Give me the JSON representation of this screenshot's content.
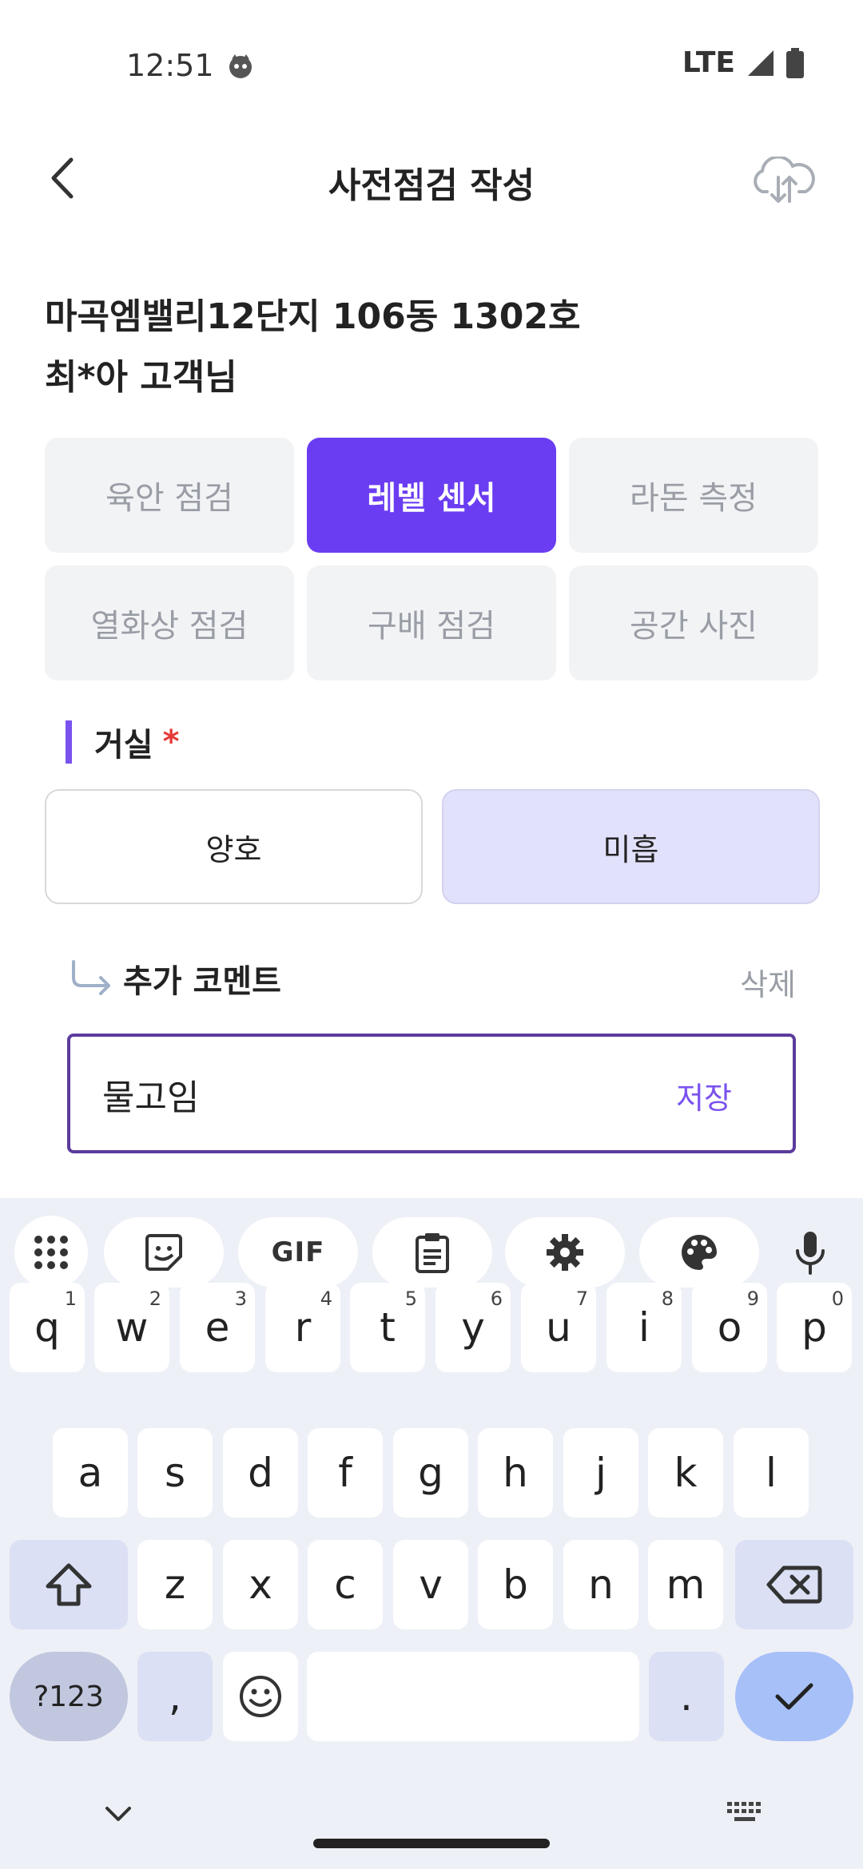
{
  "status_bar": {
    "time": "12:51",
    "network": "LTE"
  },
  "header": {
    "title": "사전점검 작성"
  },
  "customer": {
    "address": "마곡엠밸리12단지 106동 1302호",
    "name": "최*아 고객님"
  },
  "categories": [
    {
      "label": "육안 점검",
      "active": false
    },
    {
      "label": "레벨 센서",
      "active": true
    },
    {
      "label": "라돈 측정",
      "active": false
    },
    {
      "label": "열화상 점검",
      "active": false
    },
    {
      "label": "구배 점검",
      "active": false
    },
    {
      "label": "공간 사진",
      "active": false
    }
  ],
  "section": {
    "title": "거실",
    "required_mark": "*",
    "options": [
      {
        "label": "양호",
        "selected": false
      },
      {
        "label": "미흡",
        "selected": true
      }
    ]
  },
  "comment": {
    "label": "추가 코멘트",
    "delete_label": "삭제",
    "value": "물고임",
    "save_label": "저장"
  },
  "keyboard": {
    "toolbar": {
      "gif_label": "GIF"
    },
    "row1": [
      {
        "key": "q",
        "alt": "1"
      },
      {
        "key": "w",
        "alt": "2"
      },
      {
        "key": "e",
        "alt": "3"
      },
      {
        "key": "r",
        "alt": "4"
      },
      {
        "key": "t",
        "alt": "5"
      },
      {
        "key": "y",
        "alt": "6"
      },
      {
        "key": "u",
        "alt": "7"
      },
      {
        "key": "i",
        "alt": "8"
      },
      {
        "key": "o",
        "alt": "9"
      },
      {
        "key": "p",
        "alt": "0"
      }
    ],
    "row2": [
      "a",
      "s",
      "d",
      "f",
      "g",
      "h",
      "j",
      "k",
      "l"
    ],
    "row3": [
      "z",
      "x",
      "c",
      "v",
      "b",
      "n",
      "m"
    ],
    "symbols_label": "?123",
    "comma": ",",
    "period": "."
  },
  "colors": {
    "accent": "#6a3df2",
    "selected_bg": "#e2e1fb",
    "required": "#e53935"
  }
}
